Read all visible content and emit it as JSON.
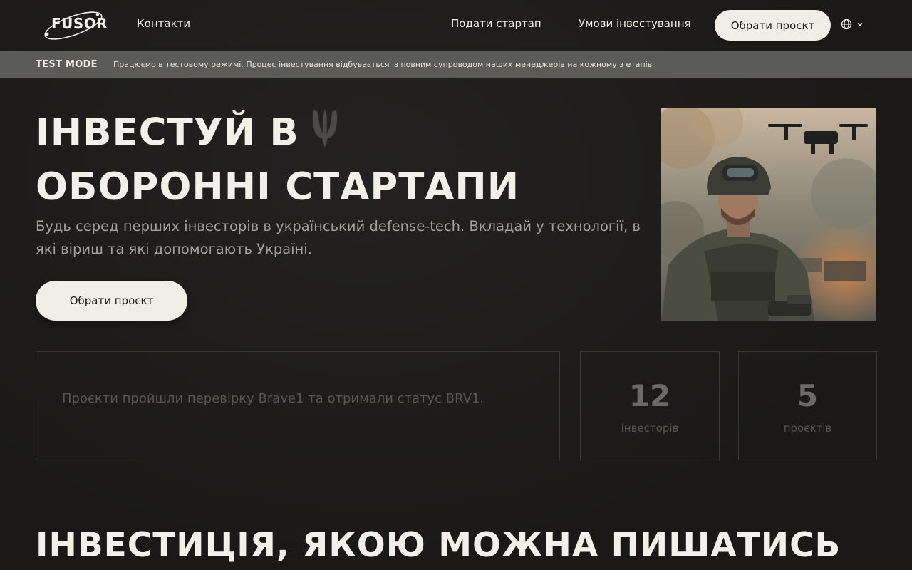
{
  "header": {
    "logo_text": "FUSOR",
    "nav_contacts": "Контакти",
    "nav_submit": "Подати стартап",
    "nav_terms": "Умови інвестування",
    "cta": "Обрати проєкт",
    "lang_icon": "globe-icon"
  },
  "testbar": {
    "label": "TEST MODE",
    "text": "Працюємо в тестовому режимі. Процес інвестування відбувається із повним супроводом наших менеджерів на кожному з етапів"
  },
  "hero": {
    "title_line1": "ІНВЕСТУЙ В",
    "title_line2": "ОБОРОННІ СТАРТАПИ",
    "subtitle": "Будь серед перших інвесторів в український defense-tech. Вкладай у технології, в які віриш та які допомогають Україні.",
    "cta": "Обрати проєкт"
  },
  "stats": {
    "text": "Проєкти пройшли перевірку Brave1 та отримали статус BRV1.",
    "investors_value": "12",
    "investors_label": "інвесторів",
    "projects_value": "5",
    "projects_label": "проєктів"
  },
  "section": {
    "title": "ІНВЕСТИЦІЯ, ЯКОЮ МОЖНА ПИШАТИСЬ"
  },
  "colors": {
    "background": "#1b1a19",
    "testbar": "#5b5c57",
    "button": "#f1eee7",
    "text": "#f3f0ea",
    "muted": "#a3a09a"
  }
}
